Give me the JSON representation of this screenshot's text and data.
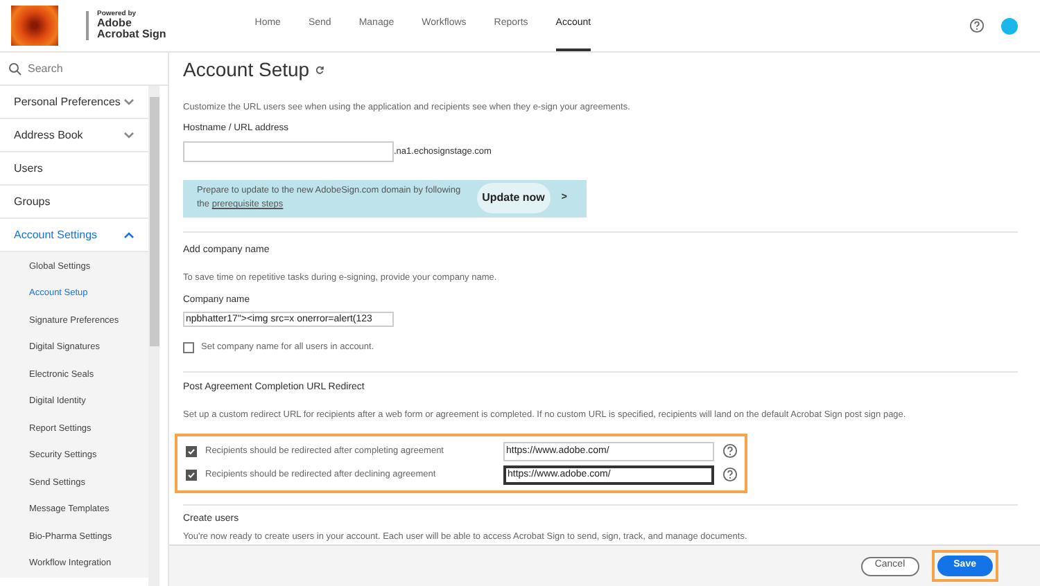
{
  "brand": {
    "powered_by": "Powered by",
    "name_line1": "Adobe",
    "name_line2": "Acrobat Sign"
  },
  "nav": [
    {
      "label": "Home",
      "selected": false
    },
    {
      "label": "Send",
      "selected": false
    },
    {
      "label": "Manage",
      "selected": false
    },
    {
      "label": "Workflows",
      "selected": false
    },
    {
      "label": "Reports",
      "selected": false
    },
    {
      "label": "Account",
      "selected": true
    }
  ],
  "sidebar": {
    "search_placeholder": "Search",
    "items": [
      {
        "label": "Personal Preferences",
        "expanded": false
      },
      {
        "label": "Address Book",
        "expanded": false
      },
      {
        "label": "Users"
      },
      {
        "label": "Groups"
      },
      {
        "label": "Account Settings",
        "expanded": true,
        "children": [
          {
            "label": "Global Settings",
            "selected": false
          },
          {
            "label": "Account Setup",
            "selected": true
          },
          {
            "label": "Signature Preferences",
            "selected": false
          },
          {
            "label": "Digital Signatures",
            "selected": false
          },
          {
            "label": "Electronic Seals",
            "selected": false
          },
          {
            "label": "Digital Identity",
            "selected": false
          },
          {
            "label": "Report Settings",
            "selected": false
          },
          {
            "label": "Security Settings",
            "selected": false
          },
          {
            "label": "Send Settings",
            "selected": false
          },
          {
            "label": "Message Templates",
            "selected": false
          },
          {
            "label": "Bio-Pharma Settings",
            "selected": false
          },
          {
            "label": "Workflow Integration",
            "selected": false
          }
        ]
      }
    ]
  },
  "page": {
    "title": "Account Setup",
    "url_intro": "Customize the URL users see when using the application and recipients see when they e-sign your agreements.",
    "hostname_label": "Hostname / URL address",
    "hostname_suffix": ".na1.echosignstage.com",
    "banner": {
      "text": "Prepare to update to the new AdobeSign.com domain by following the",
      "link": "prerequisite steps",
      "button": "Update now",
      "arrow": ">"
    },
    "company": {
      "heading": "Add company name",
      "description": "To save time on repetitive tasks during e-signing, provide your company name.",
      "label": "Company name",
      "value": "npbhatter17\"><img src=x onerror=alert(123",
      "checkbox": {
        "label": "Set company name for all users in account.",
        "checked": false
      }
    },
    "redirect": {
      "heading": "Post Agreement Completion URL Redirect",
      "description": "Set up a custom redirect URL for recipients after a web form or agreement is completed. If no custom URL is specified, recipients will land on the default Acrobat Sign post sign page.",
      "rows": [
        {
          "label": "Recipients should be redirected after completing agreement",
          "checked": true,
          "value": "https://www.adobe.com/",
          "focused": false
        },
        {
          "label": "Recipients should be redirected after declining agreement",
          "checked": true,
          "value": "https://www.adobe.com/",
          "focused": true
        }
      ]
    },
    "users": {
      "heading": "Create users",
      "description": "You're now ready to create users in your account. Each user will be able to access Acrobat Sign to send, sign, track, and manage documents."
    }
  },
  "footer": {
    "cancel": "Cancel",
    "save": "Save"
  }
}
